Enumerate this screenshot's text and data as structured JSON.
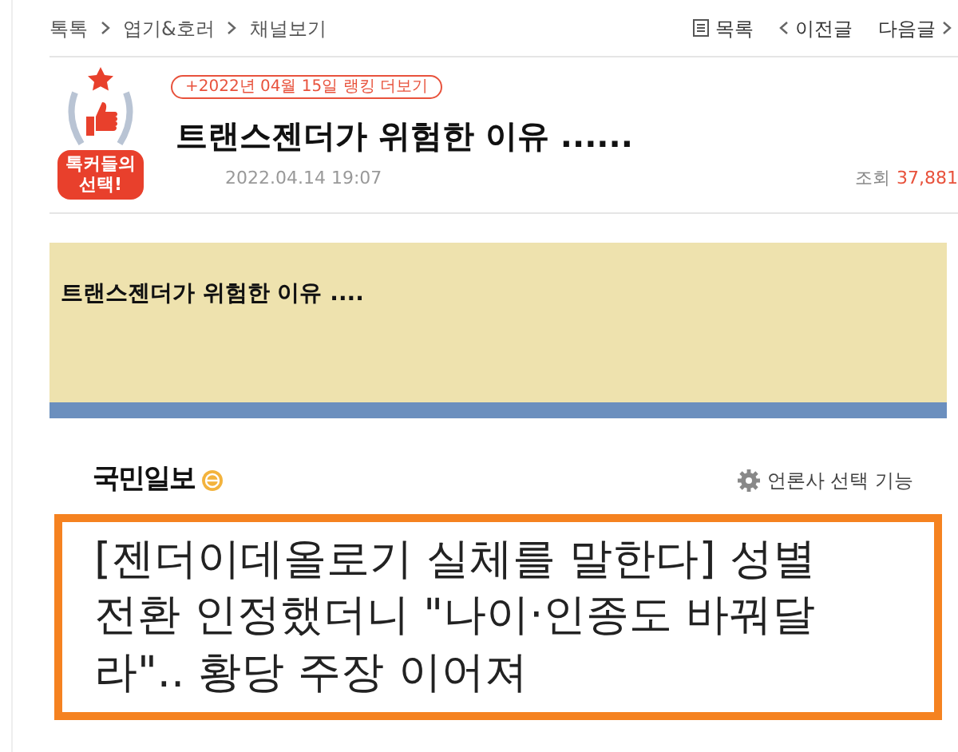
{
  "breadcrumb": [
    "톡톡",
    "엽기&호러",
    "채널보기"
  ],
  "nav": [
    {
      "kind": "list",
      "label": "목록"
    },
    {
      "kind": "prev",
      "label": "이전글"
    },
    {
      "kind": "next",
      "label": "다음글"
    }
  ],
  "badge": {
    "line1": "톡커들의",
    "line2": "선택!"
  },
  "ranking_link": "+2022년 04월 15일 랭킹 더보기",
  "title": "트랜스젠더가 위험한 이유 ......",
  "date": "2022.04.14 19:07",
  "views": {
    "label": "조회",
    "count": "37,881"
  },
  "body": {
    "banner_text": "트랜스젠더가 위험한 이유 ....",
    "news": {
      "publisher": "국민일보",
      "setting": "언론사 선택 기능",
      "headline": "[젠더이데올로기 실체를 말한다] 성별 전환 인정했더니 \"나이·인종도 바꿔달라\".. 황당 주장 이어져"
    }
  }
}
